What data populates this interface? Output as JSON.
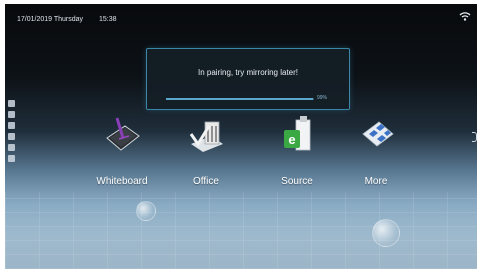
{
  "status_bar": {
    "date": "17/01/2019 Thursday",
    "time": "15:38",
    "wifi_icon": "wifi-icon"
  },
  "dialog": {
    "message": "In pairing, try mirroring later!",
    "progress_percent": 99,
    "progress_label": "99%"
  },
  "apps": [
    {
      "label": "Whiteboard",
      "icon": "whiteboard-icon"
    },
    {
      "label": "Office",
      "icon": "office-icon"
    },
    {
      "label": "Source",
      "icon": "source-icon"
    },
    {
      "label": "More",
      "icon": "more-icon"
    }
  ],
  "colors": {
    "accent": "#3c86a6",
    "progress": "#5aa7cf"
  }
}
